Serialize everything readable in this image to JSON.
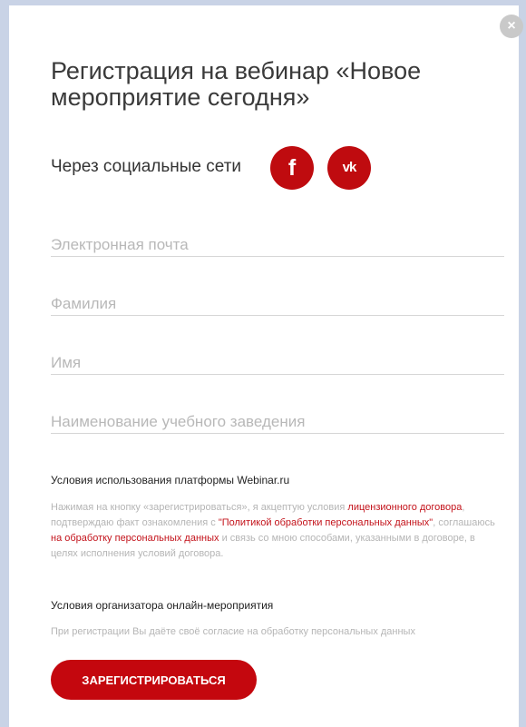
{
  "modal": {
    "title": "Регистрация на вебинар «Новое мероприятие сегодня»",
    "close_label": "×"
  },
  "social": {
    "label": "Через социальные сети",
    "buttons": [
      {
        "network": "facebook",
        "glyph": "f",
        "color": "#bf0b0f"
      },
      {
        "network": "vk",
        "glyph": "vk",
        "color": "#bf0b0f"
      }
    ]
  },
  "form": {
    "email_placeholder": "Электронная почта",
    "surname_placeholder": "Фамилия",
    "name_placeholder": "Имя",
    "institution_placeholder": "Наименование учебного заведения"
  },
  "terms": {
    "heading": "Условия использования платформы Webinar.ru",
    "text_1": "Нажимая на кнопку «зарегистрироваться», я акцептую условия ",
    "link_1": "лицензионного договора",
    "text_2": ", подтверждаю факт ознакомления с ",
    "link_2": "\"Политикой обработки персональных данных\"",
    "text_3": ", соглашаюсь ",
    "link_3": "на обработку персональных данных",
    "text_4": " и связь со мною способами, указанными в договоре, в целях исполнения условий договора."
  },
  "organizer": {
    "heading": "Условия организатора онлайн-мероприятия",
    "text": "При регистрации Вы даёте своё согласие на обработку персональных данных"
  },
  "submit_label": "ЗАРЕГИСТРИРОВАТЬСЯ",
  "colors": {
    "accent": "#c4070e",
    "link": "#c3121a",
    "backdrop": "#c9d3e6"
  }
}
